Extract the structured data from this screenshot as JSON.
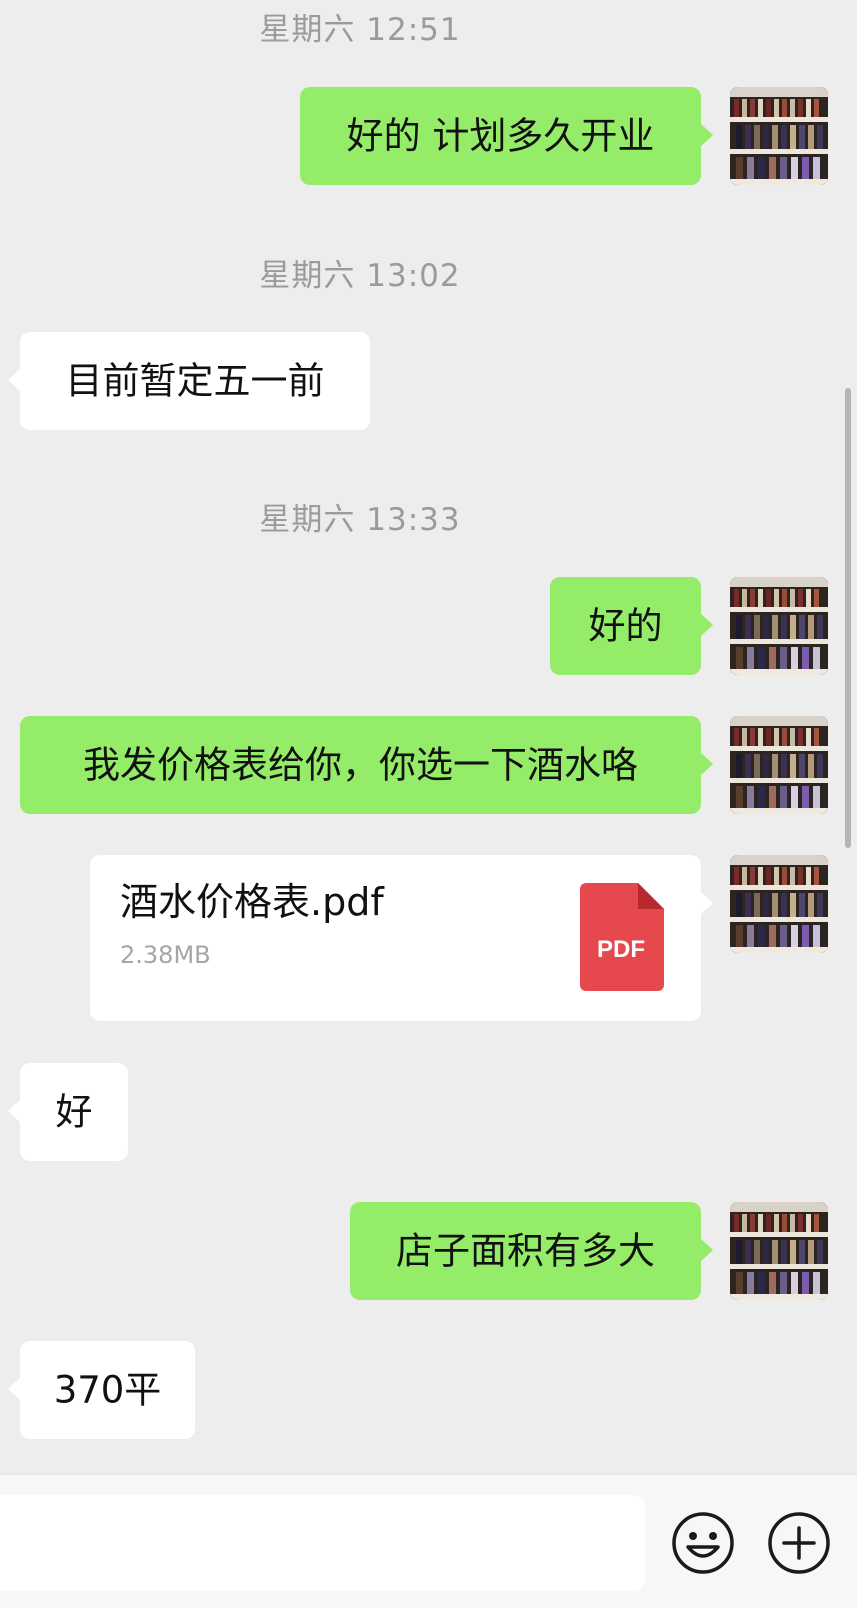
{
  "messages": {
    "ts1": "星期六 12:51",
    "m1": "好的 计划多久开业",
    "ts2": "星期六 13:02",
    "m2": "目前暂定五一前",
    "ts3": "星期六 13:33",
    "m3": "好的",
    "m4": "我发价格表给你，你选一下酒水咯",
    "file": {
      "name": "酒水价格表.pdf",
      "size": "2.38MB",
      "badge": "PDF"
    },
    "m5": "好",
    "m6": "店子面积有多大",
    "m7": "370平"
  },
  "input_bar": {
    "text_value": "",
    "icons": [
      "emoji-icon",
      "plus-icon"
    ]
  },
  "colors": {
    "sent_bubble": "#95ec69",
    "received_bubble": "#ffffff",
    "background": "#ededed",
    "pdf_red": "#e5484d"
  }
}
